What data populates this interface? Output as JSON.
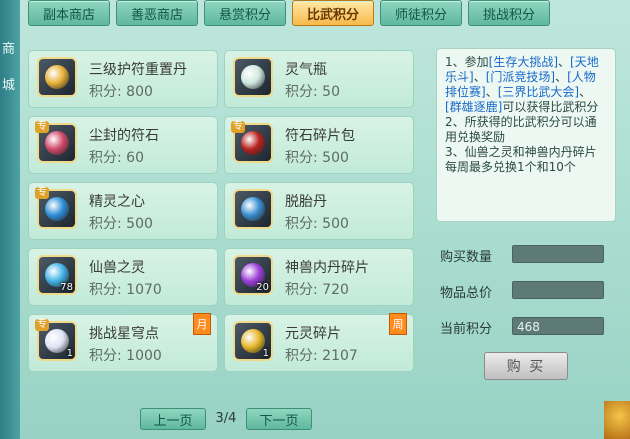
{
  "sidebar": {
    "chars": [
      "商",
      "城"
    ]
  },
  "tabs": [
    {
      "label": "副本商店",
      "active": false
    },
    {
      "label": "善恶商店",
      "active": false
    },
    {
      "label": "悬赏积分",
      "active": false
    },
    {
      "label": "比武积分",
      "active": true
    },
    {
      "label": "师徒积分",
      "active": false
    },
    {
      "label": "挑战积分",
      "active": false
    }
  ],
  "price_label": "积分:",
  "items": [
    {
      "name": "三级护符重置丹",
      "price": "800",
      "count": "",
      "special": false,
      "limit": "",
      "icon": "golden-flower-icon",
      "color": "#e9b23a"
    },
    {
      "name": "灵气瓶",
      "price": "50",
      "count": "",
      "special": false,
      "limit": "",
      "icon": "spirit-bottle-icon",
      "color": "#cfe8e0"
    },
    {
      "name": "尘封的符石",
      "price": "60",
      "count": "",
      "special": true,
      "limit": "",
      "icon": "rune-stone-icon",
      "color": "#d04a6a"
    },
    {
      "name": "符石碎片包",
      "price": "500",
      "count": "",
      "special": true,
      "limit": "",
      "icon": "red-pouch-icon",
      "color": "#b8231d"
    },
    {
      "name": "精灵之心",
      "price": "500",
      "count": "",
      "special": true,
      "limit": "",
      "icon": "spirit-heart-icon",
      "color": "#2f8fd8"
    },
    {
      "name": "脱胎丹",
      "price": "500",
      "count": "",
      "special": false,
      "limit": "",
      "icon": "blue-pill-icon",
      "color": "#3a8fd0"
    },
    {
      "name": "仙兽之灵",
      "price": "1070",
      "count": "78",
      "special": false,
      "limit": "",
      "icon": "beast-soul-icon",
      "color": "#43b3e6"
    },
    {
      "name": "神兽内丹碎片",
      "price": "720",
      "count": "20",
      "special": false,
      "limit": "",
      "icon": "purple-crystal-icon",
      "color": "#9b3fd8"
    },
    {
      "name": "挑战星穹点",
      "price": "1000",
      "count": "1",
      "special": true,
      "limit": "月",
      "icon": "crescent-moon-icon",
      "color": "#dfe4f5"
    },
    {
      "name": "元灵碎片",
      "price": "2107",
      "count": "1",
      "special": false,
      "limit": "周",
      "icon": "gold-shard-icon",
      "color": "#e6b72a"
    }
  ],
  "rules": {
    "line1_prefix": "1、参加",
    "link1": "[生存大挑战]",
    "sep1": "、",
    "link2": "[天地乐斗]",
    "sep2": "、",
    "link3": "[门派竞技场]",
    "sep3": "、",
    "link4": "[人物排位赛]",
    "sep4": "、",
    "link5": "[三界比武大会]",
    "sep5": "、",
    "link6": "[群雄逐鹿]",
    "line1_suffix": "可以获得比武积分",
    "line2": "2、所获得的比武积分可以通用兑换奖励",
    "line3": "3、仙兽之灵和神兽内丹碎片每周最多兑换1个和10个"
  },
  "fields": {
    "buy_qty_label": "购买数量",
    "buy_qty_value": "",
    "total_label": "物品总价",
    "total_value": "",
    "current_label": "当前积分",
    "current_value": "468"
  },
  "buy_button": "购 买",
  "pager": {
    "prev": "上一页",
    "page": "3/4",
    "next": "下一页"
  }
}
